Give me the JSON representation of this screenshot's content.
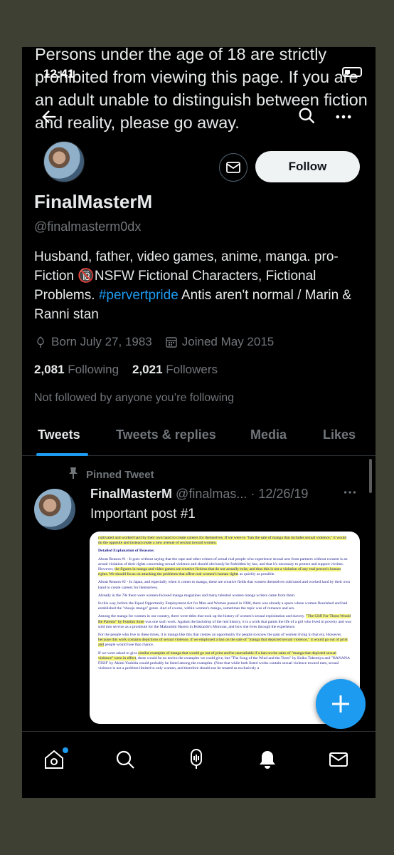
{
  "status_bar": {
    "time": "12:41"
  },
  "warning_text": "Persons under the age of 18 are strictly prohibited from viewing this page. If you are an adult unable to distinguish between fiction and reality, please go away.",
  "profile": {
    "display_name": "FinalMasterM",
    "handle": "@finalmasterm0dx",
    "follow_label": "Follow",
    "bio_part1": "Husband, father, video games, anime, manga. pro-Fiction 🔞NSFW Fictional Characters, Fictional Problems. ",
    "bio_hashtag": "#pervertpride",
    "bio_part2": " Antis aren't normal / Marin & Ranni stan",
    "born": "Born July 27, 1983",
    "joined": "Joined May 2015",
    "following_count": "2,081",
    "following_label": "Following",
    "followers_count": "2,021",
    "followers_label": "Followers",
    "not_followed": "Not followed by anyone you’re following"
  },
  "tabs": [
    {
      "label": "Tweets"
    },
    {
      "label": "Tweets & replies"
    },
    {
      "label": "Media"
    },
    {
      "label": "Likes"
    }
  ],
  "tweet": {
    "pinned_label": "Pinned Tweet",
    "author": "FinalMasterM",
    "handle": "@finalmas...",
    "date": "· 12/26/19",
    "text": "Important post #1"
  },
  "doc": {
    "p0": "cultivated and worked hard by their own hand to create careers for themselves. If we were to \"ban the sale of manga that includes sexual violence,\" it would do the opposite and instead create a new avenue of sexism toward women.",
    "h1": "Detailed Explanation of Reasons:",
    "p1a": "About Reason #1 - It goes without saying that the rape and other crimes of actual real people who experience sexual acts from partners without consent is an actual violation of their rights concerning sexual violence and should obviously be forbidden by law, and that it's necessary to protect and support victims. However, ",
    "p1hl": "the figures in manga and video games are creative fictions that do not actually exist, and thus this is not a violation of any real person's human rights. We should focus on attacking the problems that affect real women's human rights",
    "p1b": " as quickly as possible.",
    "p2": "About Reason #2 - In Japan, and especially when it comes to manga, these are creative fields that women themselves cultivated and worked hard by their own hand to create careers for themselves.",
    "p3": "Already in the 70s there were women-focused manga magazines and many talented women manga writers came from them.",
    "p4": "In this way, before the Equal Opportunity Employment Act for Men and Women passed in 1986, there was already a space where women flourished and had established the \"shoujo manga\" genre. And of course, within women's manga, sometimes the topic was of romance and sex.",
    "p5a": "Among the manga for women in our country, there were titles that took up the history of women's sexual exploitation and slavery. ",
    "p5hl": "\"The Cliff For Those Would Be Parents\" by Fumiko Sone",
    "p5b": " was one such work. Against the backdrop of the real history, it is a work that paints the life of a girl who lived in poverty and was sold into service as a prostitute for the Makunishi Harem in Hokkaido's Muroran, and how she lives through the experience.",
    "p6a": "For the people who live in these times, it is manga like this that creates an opportunity for people to know the pain of women living in that era. However, ",
    "p6hl": "because this work contains depictions of sexual violence, if we employed a ban on the sale of \"manga that depicted sexual violence,\" it would go out of print and",
    "p6b": " people would lose that chance.",
    "p7a": "If we were asked to give ",
    "p7hl": "similar examples of manga that would go out of print and be unavailable if a ban on the sales of \"manga that depicted sexual violence\" were in effect",
    "p7b": ", there would be no end to the examples we could give, but \"The Song of the Wind and the Trees\" by Keiko Takemiya and \"BANANA FISH\" by Akimi Yoshida would probably be listed among the examples. (Note that while both listed works contain sexual violence toward men, sexual violence is not a problem limited to only women, and therefore should not be treated as exclusively a"
  },
  "colors": {
    "accent": "#1d9bf0",
    "background": "#000000",
    "muted": "#71767b"
  },
  "icons": [
    "back-arrow-icon",
    "search-icon",
    "more-icon",
    "mail-icon",
    "birthday-icon",
    "calendar-icon",
    "pin-icon",
    "compose-plus-icon",
    "home-icon",
    "explore-icon",
    "spaces-icon",
    "notifications-icon",
    "messages-icon"
  ]
}
